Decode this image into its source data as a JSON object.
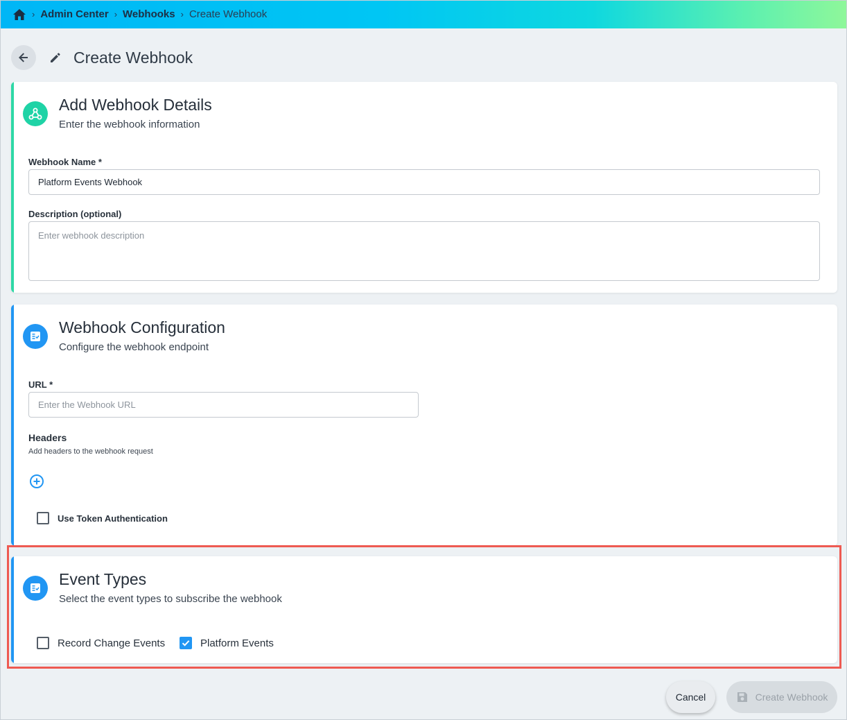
{
  "breadcrumb": {
    "items": [
      "Admin Center",
      "Webhooks",
      "Create Webhook"
    ],
    "separator": "›"
  },
  "page": {
    "title": "Create Webhook"
  },
  "details_card": {
    "title": "Add Webhook Details",
    "subtitle": "Enter the webhook information",
    "name_label": "Webhook Name *",
    "name_value": "Platform Events Webhook",
    "description_label": "Description (optional)",
    "description_placeholder": "Enter webhook description"
  },
  "config_card": {
    "title": "Webhook Configuration",
    "subtitle": "Configure the webhook endpoint",
    "url_label": "URL *",
    "url_placeholder": "Enter the Webhook URL",
    "headers_label": "Headers",
    "headers_help": "Add headers to the webhook request",
    "token_auth_label": "Use Token Authentication",
    "token_auth_checked": false
  },
  "events_card": {
    "title": "Event Types",
    "subtitle": "Select the event types to subscribe the webhook",
    "options": [
      {
        "label": "Record Change Events",
        "checked": false
      },
      {
        "label": "Platform Events",
        "checked": true
      }
    ]
  },
  "actions": {
    "cancel_label": "Cancel",
    "create_label": "Create Webhook"
  },
  "colors": {
    "accent_blue": "#2196f3",
    "accent_green": "#1fd3a6",
    "highlight_red": "#ee5a52"
  }
}
